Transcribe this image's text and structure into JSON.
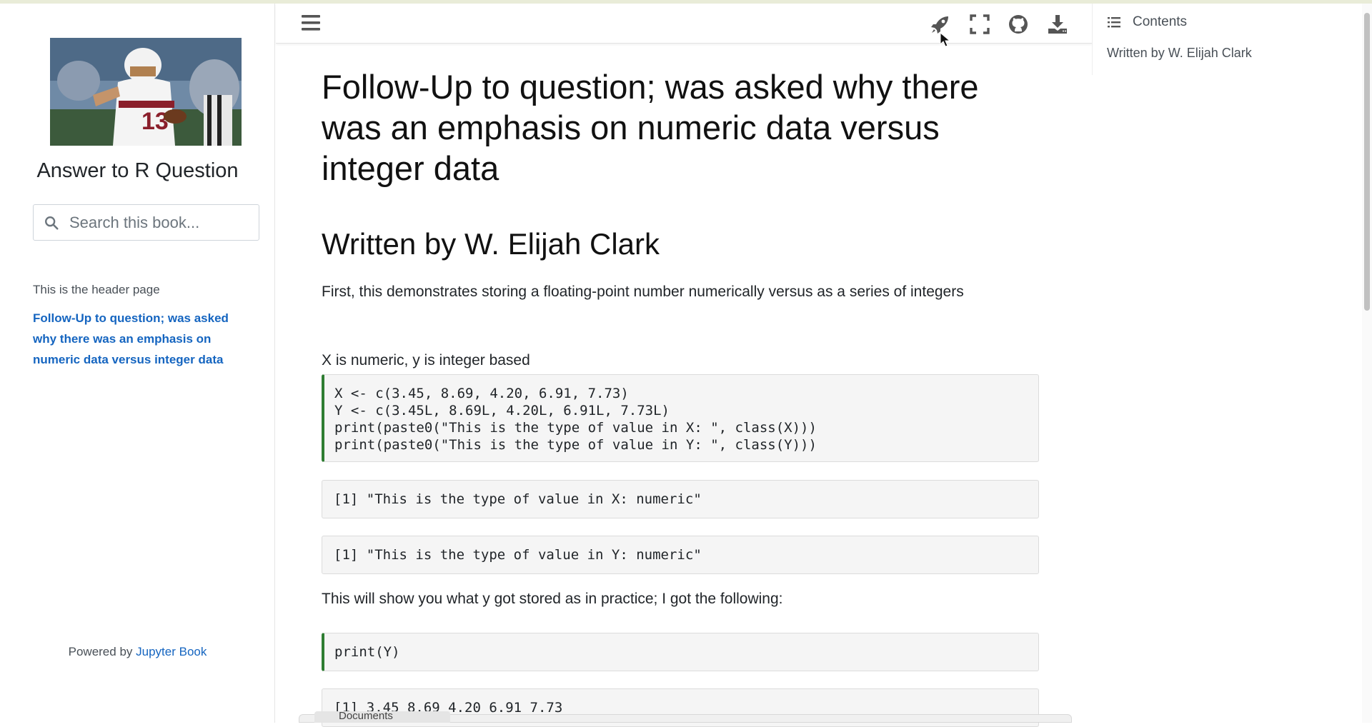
{
  "sidebar": {
    "site_title": "Answer to R Question",
    "search_placeholder": "Search this book...",
    "nav_caption": "This is the header page",
    "nav_link": "Follow-Up to question; was asked why there was an emphasis on numeric data versus integer data",
    "powered_by": "Powered by",
    "powered_link": "Jupyter Book"
  },
  "header": {
    "icons": [
      "menu-icon",
      "rocket-icon",
      "fullscreen-icon",
      "github-icon",
      "download-icon"
    ]
  },
  "toc": {
    "title": "Contents",
    "items": [
      "Written by W. Elijah Clark"
    ]
  },
  "main": {
    "title": "Follow-Up to question; was asked why there was an emphasis on numeric data versus integer data",
    "byline": "Written by W. Elijah Clark",
    "intro": "First, this demonstrates storing a floating-point number numerically versus as a series of integers",
    "label_xy": "X is numeric, y is integer based",
    "code1": {
      "lines": [
        "X <- c(3.45, 8.69, 4.20, 6.91, 7.73)",
        "Y <- c(3.45L, 8.69L, 4.20L, 6.91L, 7.73L)",
        "print(paste0(\"This is the type of value in X: \", class(X)))",
        "print(paste0(\"This is the type of value in Y: \", class(Y)))"
      ]
    },
    "output1": "[1] \"This is the type of value in X: numeric\"",
    "output2": "[1] \"This is the type of value in Y: numeric\"",
    "label_practice": "This will show you what y got stored as in practice; I got the following:",
    "code2": "print(Y)",
    "output3": "[1] 3.45 8.69 4.20 6.91 7.73"
  },
  "taskbar": {
    "tab_label": "Documents"
  },
  "colors": {
    "link": "#1565c0",
    "code_border": "#2e7d32",
    "code_bg": "#f5f5f5"
  }
}
